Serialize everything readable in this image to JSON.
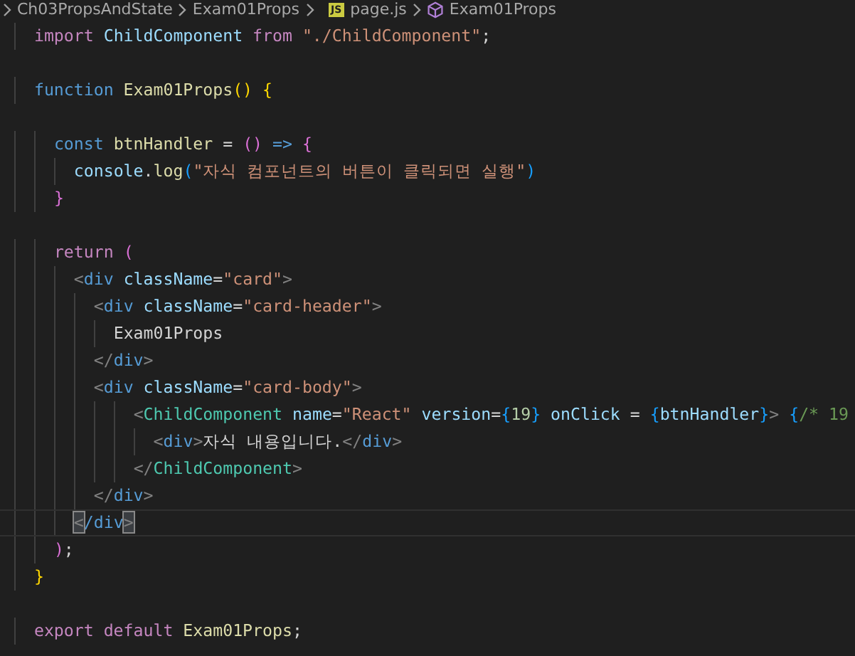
{
  "breadcrumb": [
    {
      "kind": "folder",
      "label": "Ch03PropsAndState"
    },
    {
      "kind": "folder",
      "label": "Exam01Props"
    },
    {
      "kind": "js-file",
      "badge": "JS",
      "label": "page.js"
    },
    {
      "kind": "symbol",
      "label": "Exam01Props"
    }
  ],
  "lines": [
    {
      "current": false,
      "tokens": [
        {
          "kind": "kw",
          "text": "  import "
        },
        {
          "kind": "var",
          "text": "ChildComponent "
        },
        {
          "kind": "kw",
          "text": "from "
        },
        {
          "kind": "str",
          "text": "\"./ChildComponent\""
        },
        {
          "kind": "plain",
          "text": ";"
        }
      ]
    },
    {
      "current": false
    },
    {
      "current": false,
      "tokens": [
        {
          "kind": "storage",
          "text": "  function "
        },
        {
          "kind": "fn",
          "text": "Exam01Props"
        },
        {
          "kind": "b1",
          "text": "() {"
        }
      ]
    },
    {
      "current": false
    },
    {
      "current": false,
      "tokens": [
        {
          "kind": "storage",
          "text": "    const "
        },
        {
          "kind": "fn",
          "text": "btnHandler "
        },
        {
          "kind": "plain",
          "text": "= "
        },
        {
          "kind": "b2",
          "text": "() "
        },
        {
          "kind": "storage",
          "text": "=> "
        },
        {
          "kind": "b2",
          "text": "{"
        }
      ]
    },
    {
      "current": false,
      "tokens": [
        {
          "kind": "var",
          "text": "      console"
        },
        {
          "kind": "plain",
          "text": "."
        },
        {
          "kind": "fn",
          "text": "log"
        },
        {
          "kind": "b3",
          "text": "("
        },
        {
          "kind": "str",
          "text": "\"자식 컴포넌트의 버튼이 클릭되면 실행\""
        },
        {
          "kind": "b3",
          "text": ")"
        }
      ]
    },
    {
      "current": false,
      "tokens": [
        {
          "kind": "b2",
          "text": "    }"
        }
      ]
    },
    {
      "current": false
    },
    {
      "current": false,
      "tokens": [
        {
          "kind": "kw",
          "text": "    return "
        },
        {
          "kind": "b2",
          "text": "("
        }
      ]
    },
    {
      "current": false,
      "tokens": [
        {
          "kind": "angle",
          "text": "      <"
        },
        {
          "kind": "tag",
          "text": "div "
        },
        {
          "kind": "var",
          "text": "className"
        },
        {
          "kind": "plain",
          "text": "="
        },
        {
          "kind": "str",
          "text": "\"card\""
        },
        {
          "kind": "angle",
          "text": ">"
        }
      ]
    },
    {
      "current": false,
      "tokens": [
        {
          "kind": "angle",
          "text": "        <"
        },
        {
          "kind": "tag",
          "text": "div "
        },
        {
          "kind": "var",
          "text": "className"
        },
        {
          "kind": "plain",
          "text": "="
        },
        {
          "kind": "str",
          "text": "\"card-header\""
        },
        {
          "kind": "angle",
          "text": ">"
        }
      ]
    },
    {
      "current": false,
      "tokens": [
        {
          "kind": "plain",
          "text": "          Exam01Props"
        }
      ]
    },
    {
      "current": false,
      "tokens": [
        {
          "kind": "angle",
          "text": "        </"
        },
        {
          "kind": "tag",
          "text": "div"
        },
        {
          "kind": "angle",
          "text": ">"
        }
      ]
    },
    {
      "current": false,
      "tokens": [
        {
          "kind": "angle",
          "text": "        <"
        },
        {
          "kind": "tag",
          "text": "div "
        },
        {
          "kind": "var",
          "text": "className"
        },
        {
          "kind": "plain",
          "text": "="
        },
        {
          "kind": "str",
          "text": "\"card-body\""
        },
        {
          "kind": "angle",
          "text": ">"
        }
      ]
    },
    {
      "current": false,
      "tokens": [
        {
          "kind": "angle",
          "text": "            <"
        },
        {
          "kind": "comp",
          "text": "ChildComponent "
        },
        {
          "kind": "var",
          "text": "name"
        },
        {
          "kind": "plain",
          "text": "="
        },
        {
          "kind": "str",
          "text": "\"React\" "
        },
        {
          "kind": "var",
          "text": "version"
        },
        {
          "kind": "plain",
          "text": "="
        },
        {
          "kind": "b3",
          "text": "{"
        },
        {
          "kind": "num",
          "text": "19"
        },
        {
          "kind": "b3",
          "text": "} "
        },
        {
          "kind": "var",
          "text": "onClick "
        },
        {
          "kind": "plain",
          "text": "= "
        },
        {
          "kind": "b3",
          "text": "{"
        },
        {
          "kind": "var",
          "text": "btnHandler"
        },
        {
          "kind": "b3",
          "text": "}"
        },
        {
          "kind": "angle",
          "text": "> "
        },
        {
          "kind": "b3",
          "text": "{"
        },
        {
          "kind": "comment",
          "text": "/* 19"
        }
      ]
    },
    {
      "current": false,
      "tokens": [
        {
          "kind": "angle",
          "text": "              <"
        },
        {
          "kind": "tag",
          "text": "div"
        },
        {
          "kind": "angle",
          "text": ">"
        },
        {
          "kind": "plain",
          "text": "자식 내용입니다."
        },
        {
          "kind": "angle",
          "text": "</"
        },
        {
          "kind": "tag",
          "text": "div"
        },
        {
          "kind": "angle",
          "text": ">"
        }
      ]
    },
    {
      "current": false,
      "tokens": [
        {
          "kind": "angle",
          "text": "            </"
        },
        {
          "kind": "comp",
          "text": "ChildComponent"
        },
        {
          "kind": "angle",
          "text": ">"
        }
      ]
    },
    {
      "current": false,
      "tokens": [
        {
          "kind": "angle",
          "text": "        </"
        },
        {
          "kind": "tag",
          "text": "div"
        },
        {
          "kind": "angle",
          "text": ">"
        }
      ]
    },
    {
      "current": true,
      "tokens": [
        {
          "kind": "bracket-match",
          "text": "      <"
        },
        {
          "kind": "tag",
          "text": "/div"
        },
        {
          "kind": "bracket-match",
          "text": ">"
        }
      ]
    },
    {
      "current": false,
      "tokens": [
        {
          "kind": "b2",
          "text": "    )"
        },
        {
          "kind": "plain",
          "text": ";"
        }
      ]
    },
    {
      "current": false,
      "tokens": [
        {
          "kind": "b1",
          "text": "  }"
        }
      ]
    },
    {
      "current": false
    },
    {
      "current": false,
      "tokens": [
        {
          "kind": "kw",
          "text": "  export default "
        },
        {
          "kind": "fn",
          "text": "Exam01Props"
        },
        {
          "kind": "plain",
          "text": ";"
        }
      ]
    }
  ]
}
